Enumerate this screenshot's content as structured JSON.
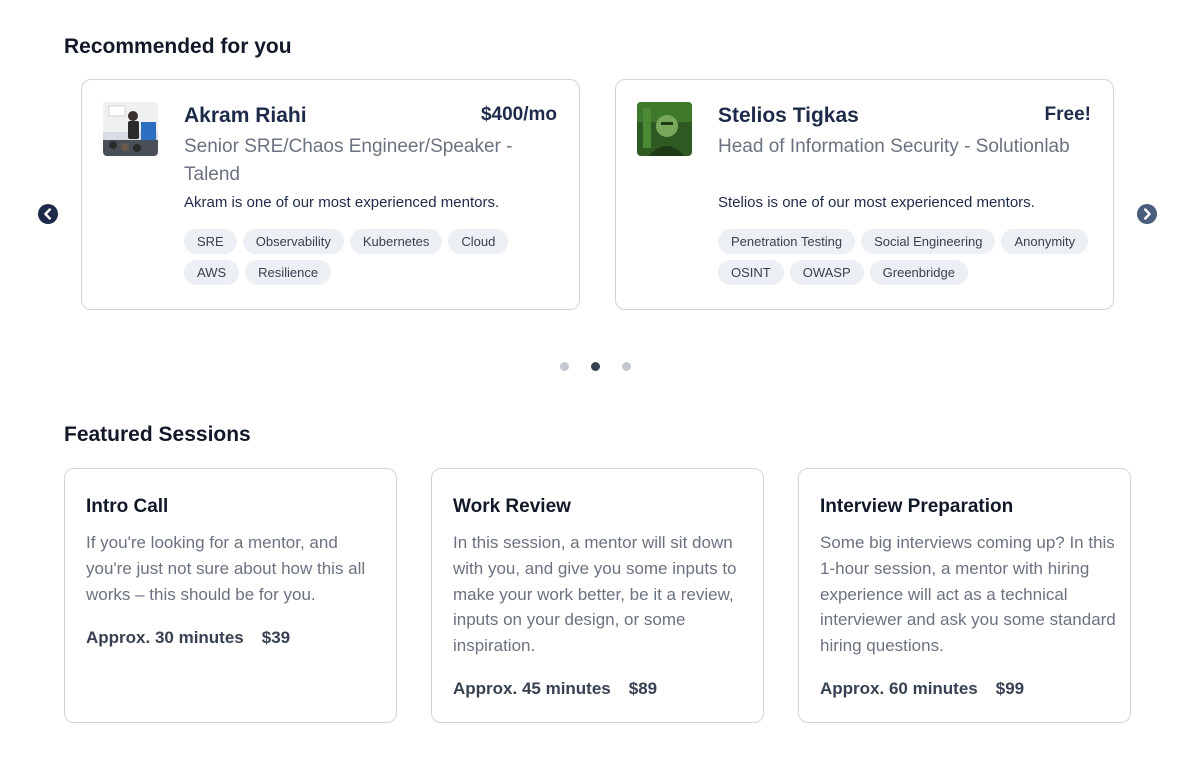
{
  "recommended": {
    "title": "Recommended for you",
    "mentors": [
      {
        "name": "Akram Riahi",
        "price": "$400/mo",
        "role": "Senior SRE/Chaos Engineer/Speaker - Talend",
        "description": "Akram is one of our most experienced mentors.",
        "tags": [
          "SRE",
          "Observability",
          "Kubernetes",
          "Cloud",
          "AWS",
          "Resilience"
        ]
      },
      {
        "name": "Stelios Tigkas",
        "price": "Free!",
        "role": "Head of Information Security - Solutionlab",
        "description": "Stelios is one of our most experienced mentors.",
        "tags": [
          "Penetration Testing",
          "Social Engineering",
          "Anonymity",
          "OSINT",
          "OWASP",
          "Greenbridge"
        ]
      }
    ],
    "carousel": {
      "page_count": 3,
      "active_page": 2
    }
  },
  "featured": {
    "title": "Featured Sessions",
    "sessions": [
      {
        "title": "Intro Call",
        "description": "If you're looking for a mentor, and you're just not sure about how this all works – this should be for you.",
        "duration": "Approx. 30 minutes",
        "price": "$39"
      },
      {
        "title": "Work Review",
        "description": "In this session, a mentor will sit down with you, and give you some inputs to make your work better, be it a review, inputs on your design, or some inspiration.",
        "duration": "Approx. 45 minutes",
        "price": "$89"
      },
      {
        "title": "Interview Preparation",
        "description": "Some big interviews coming up? In this 1-hour session, a mentor with hiring experience will act as a technical interviewer and ask you some standard hiring questions.",
        "duration": "Approx. 60 minutes",
        "price": "$99"
      }
    ]
  },
  "icons": {
    "prev": "chevron-left-circle-icon",
    "next": "chevron-right-circle-icon"
  },
  "colors": {
    "heading": "#111827",
    "name": "#1e2a4a",
    "muted": "#6b7280",
    "tag_bg": "#eceff3",
    "border": "#d1d5db",
    "arrow_left": "#1e2a4a",
    "arrow_right": "#4b5d7e"
  }
}
